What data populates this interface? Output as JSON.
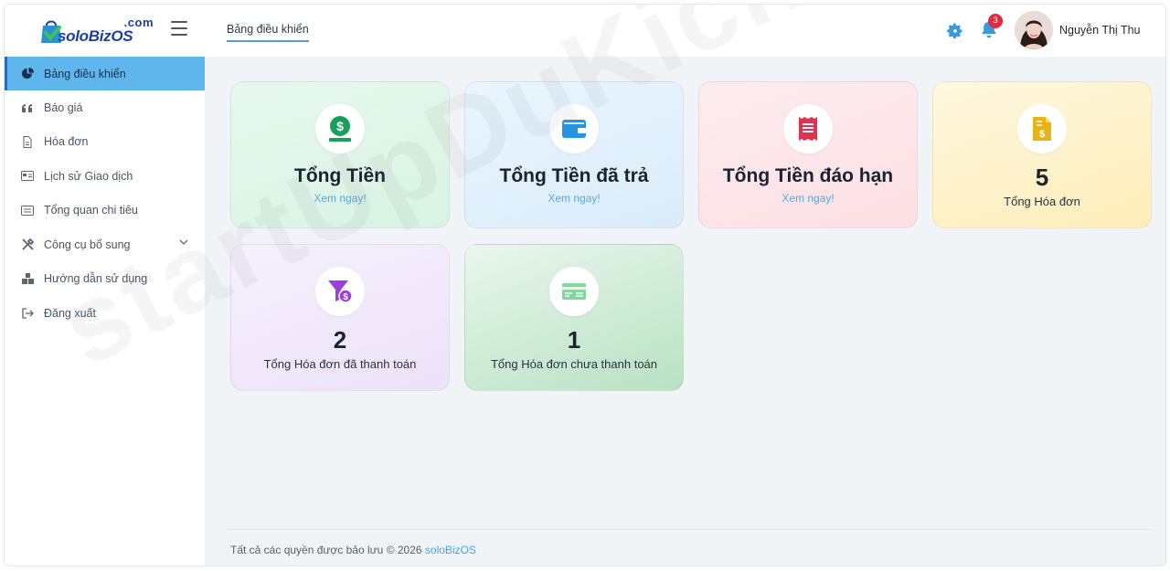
{
  "app": {
    "logo_com": ".com",
    "logo_brand": "soloBizOS"
  },
  "header": {
    "tab_label": "Bảng điều khiển",
    "notification_count": "3",
    "user_name": "Nguyễn Thị Thu"
  },
  "sidebar": {
    "items": [
      {
        "label": "Bảng điều khiển",
        "icon": "pie-chart-icon",
        "active": true
      },
      {
        "label": "Báo giá",
        "icon": "quote-icon"
      },
      {
        "label": "Hóa đơn",
        "icon": "file-icon"
      },
      {
        "label": "Lịch sử Giao dịch",
        "icon": "card-icon"
      },
      {
        "label": "Tổng quan chi tiêu",
        "icon": "list-card-icon"
      },
      {
        "label": "Công cụ bổ sung",
        "icon": "tools-icon",
        "has_submenu": true
      },
      {
        "label": "Hướng dẫn sử dụng",
        "icon": "cubes-icon"
      },
      {
        "label": "Đăng xuất",
        "icon": "logout-icon"
      }
    ]
  },
  "cards": [
    {
      "title": "Tổng Tiền",
      "link": "Xem ngay!",
      "icon": "money-hand-icon",
      "icon_color": "#16a05a"
    },
    {
      "title": "Tổng Tiền đã trả",
      "link": "Xem ngay!",
      "icon": "wallet-icon",
      "icon_color": "#2595e0"
    },
    {
      "title": "Tổng Tiền đáo hạn",
      "link": "Xem ngay!",
      "icon": "receipt-icon",
      "icon_color": "#e0314f"
    },
    {
      "value": "5",
      "label": "Tổng Hóa đơn",
      "icon": "invoice-dollar-icon",
      "icon_color": "#e6b318"
    },
    {
      "value": "2",
      "label": "Tổng Hóa đơn đã thanh toán",
      "icon": "funnel-dollar-icon",
      "icon_color": "#9c3fd8"
    },
    {
      "value": "1",
      "label": "Tổng Hóa đơn chưa thanh toán",
      "icon": "money-bill-icon",
      "icon_color": "#7ed89a"
    }
  ],
  "footer": {
    "text": "Tất cả các quyền được bảo lưu © 2026",
    "link": "soloBizOS"
  },
  "watermark": "startUpDuKich.com"
}
